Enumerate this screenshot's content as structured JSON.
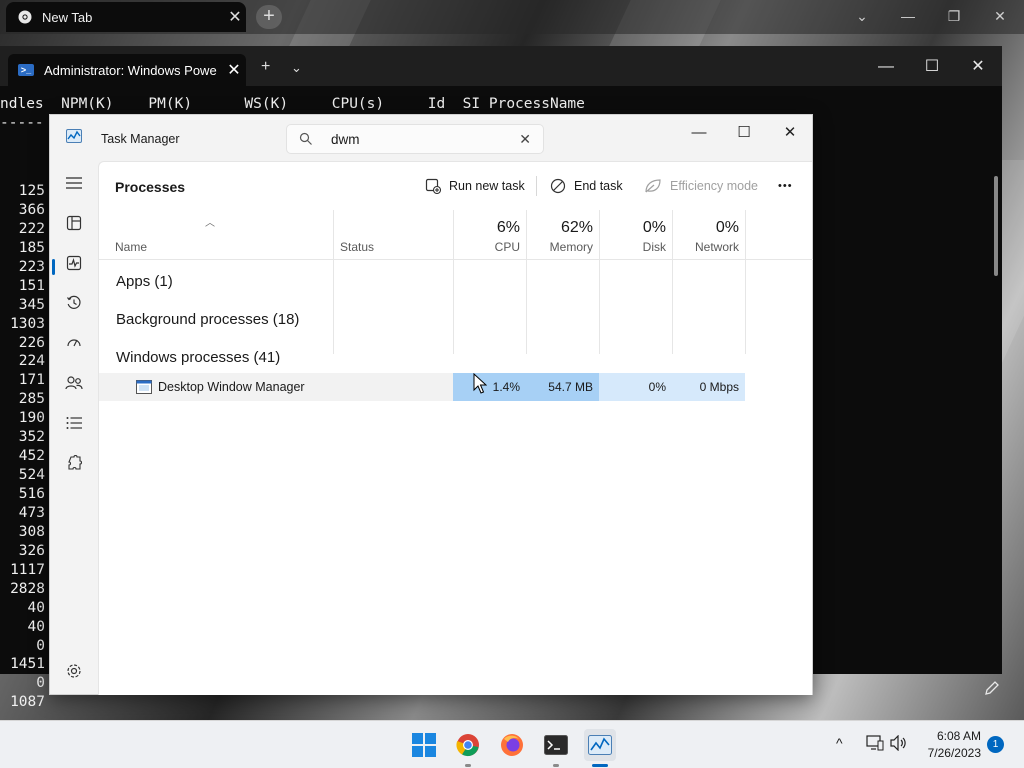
{
  "chrome": {
    "tab_title": "New Tab",
    "tab_close": "✕",
    "new_tab": "+"
  },
  "terminal": {
    "tab_title": "Administrator: Windows Powe",
    "tab_close": "✕",
    "new_tab": "+",
    "dropdown": "⌄",
    "minimize": "—",
    "maximize": "☐",
    "close": "✕",
    "header": "ndles  NPM(K)    PM(K)      WS(K)     CPU(s)     Id  SI ProcessName",
    "dashes": "-----",
    "handles": [
      "125",
      "366",
      "222",
      "185",
      "223",
      "151",
      "345",
      "1303",
      "226",
      "224",
      "171",
      "285",
      "190",
      "352",
      "452",
      "524",
      "516",
      "473",
      "308",
      "326",
      "1117",
      "2828",
      "40",
      "40",
      "0",
      "1451",
      "0",
      "1087"
    ]
  },
  "taskmgr": {
    "title": "Task Manager",
    "search": {
      "value": "dwm",
      "clear": "✕"
    },
    "window": {
      "minimize": "—",
      "maximize": "☐",
      "close": "✕"
    },
    "page_title": "Processes",
    "toolbar": {
      "run_new_task": "Run new task",
      "end_task": "End task",
      "efficiency_mode": "Efficiency mode",
      "more": "•••"
    },
    "columns": {
      "name": "Name",
      "status": "Status",
      "cpu": {
        "pct": "6%",
        "label": "CPU"
      },
      "memory": {
        "pct": "62%",
        "label": "Memory"
      },
      "disk": {
        "pct": "0%",
        "label": "Disk"
      },
      "network": {
        "pct": "0%",
        "label": "Network"
      }
    },
    "groups": {
      "apps": "Apps (1)",
      "background": "Background processes (18)",
      "windows": "Windows processes (41)"
    },
    "process": {
      "name": "Desktop Window Manager",
      "cpu": "1.4%",
      "memory": "54.7 MB",
      "disk": "0%",
      "network": "0 Mbps"
    }
  },
  "taskbar": {
    "tray_chevron": "^",
    "time": "6:08 AM",
    "date": "7/26/2023",
    "notifications": "1"
  },
  "colors": {
    "accent": "#0067c0",
    "heat_strong": "#a7d0f5",
    "heat_light": "#d6e9fb",
    "ps_blue": "#2b6cc4"
  }
}
